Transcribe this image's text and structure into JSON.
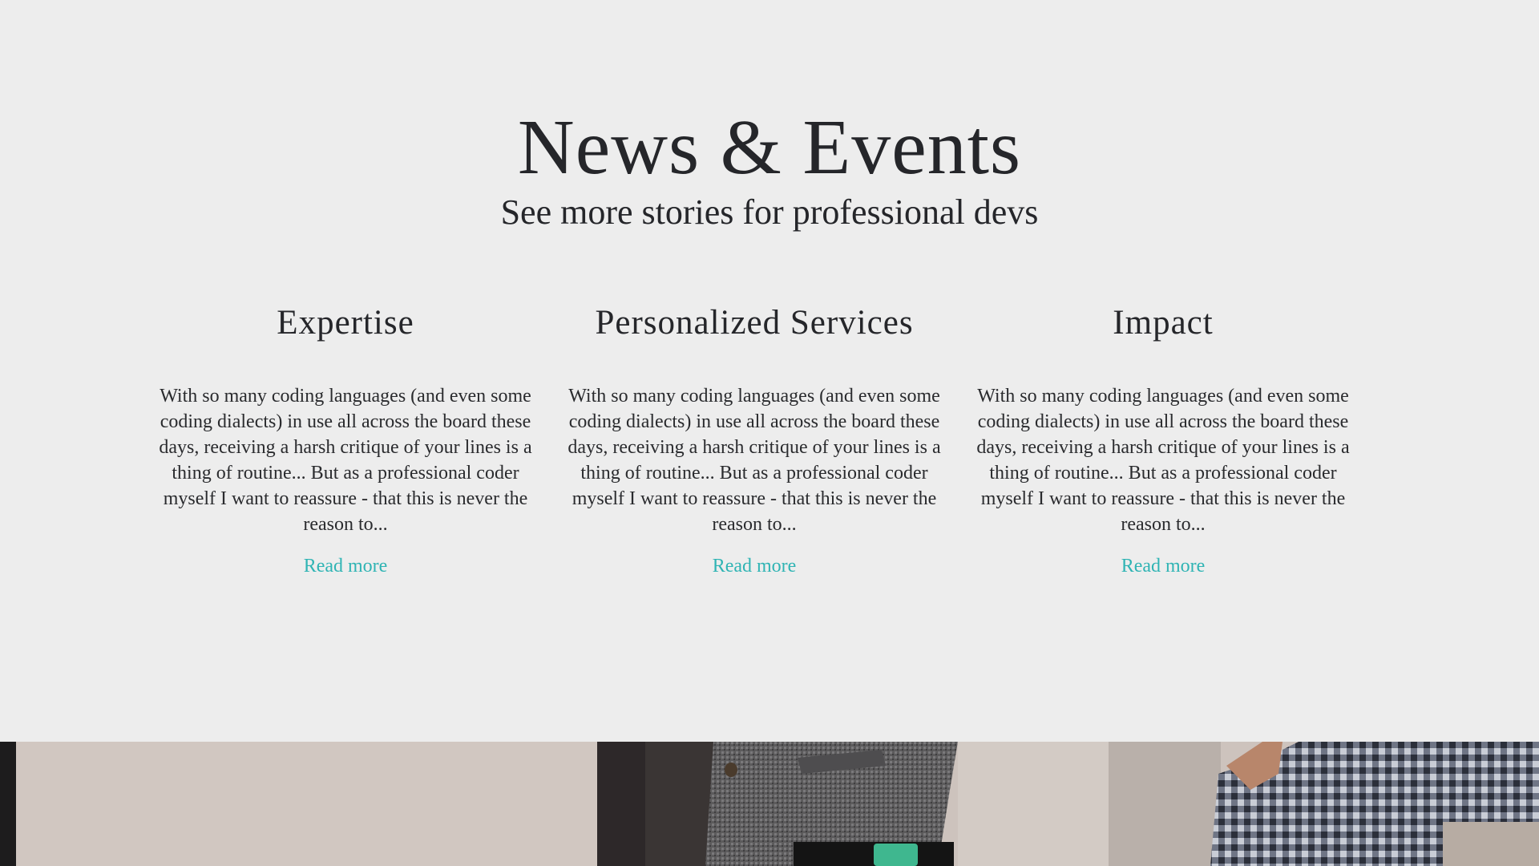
{
  "section": {
    "title": "News & Events",
    "subtitle": "See more stories for professional devs"
  },
  "columns": [
    {
      "heading": "Expertise",
      "text": "With so many coding languages (and even some coding dialects) in use all across the board these days, receiving a harsh critique of your lines is a thing of routine... But as a professional coder myself I want to reassure - that this is never the reason to...",
      "link": "Read more"
    },
    {
      "heading": "Personalized Services",
      "text": "With so many coding languages (and even some coding dialects) in use all across the board these days, receiving a harsh critique of your lines is a thing of routine... But as a professional coder myself I want to reassure - that this is never the reason to...",
      "link": "Read more"
    },
    {
      "heading": "Impact",
      "text": "With so many coding languages (and even some coding dialects) in use all across the board these days, receiving a harsh critique of your lines is a thing of routine... But as a professional coder myself I want to reassure - that this is never the reason to...",
      "link": "Read more"
    }
  ],
  "colors": {
    "background": "#ededed",
    "text": "#25262a",
    "link": "#2fb4b4"
  }
}
